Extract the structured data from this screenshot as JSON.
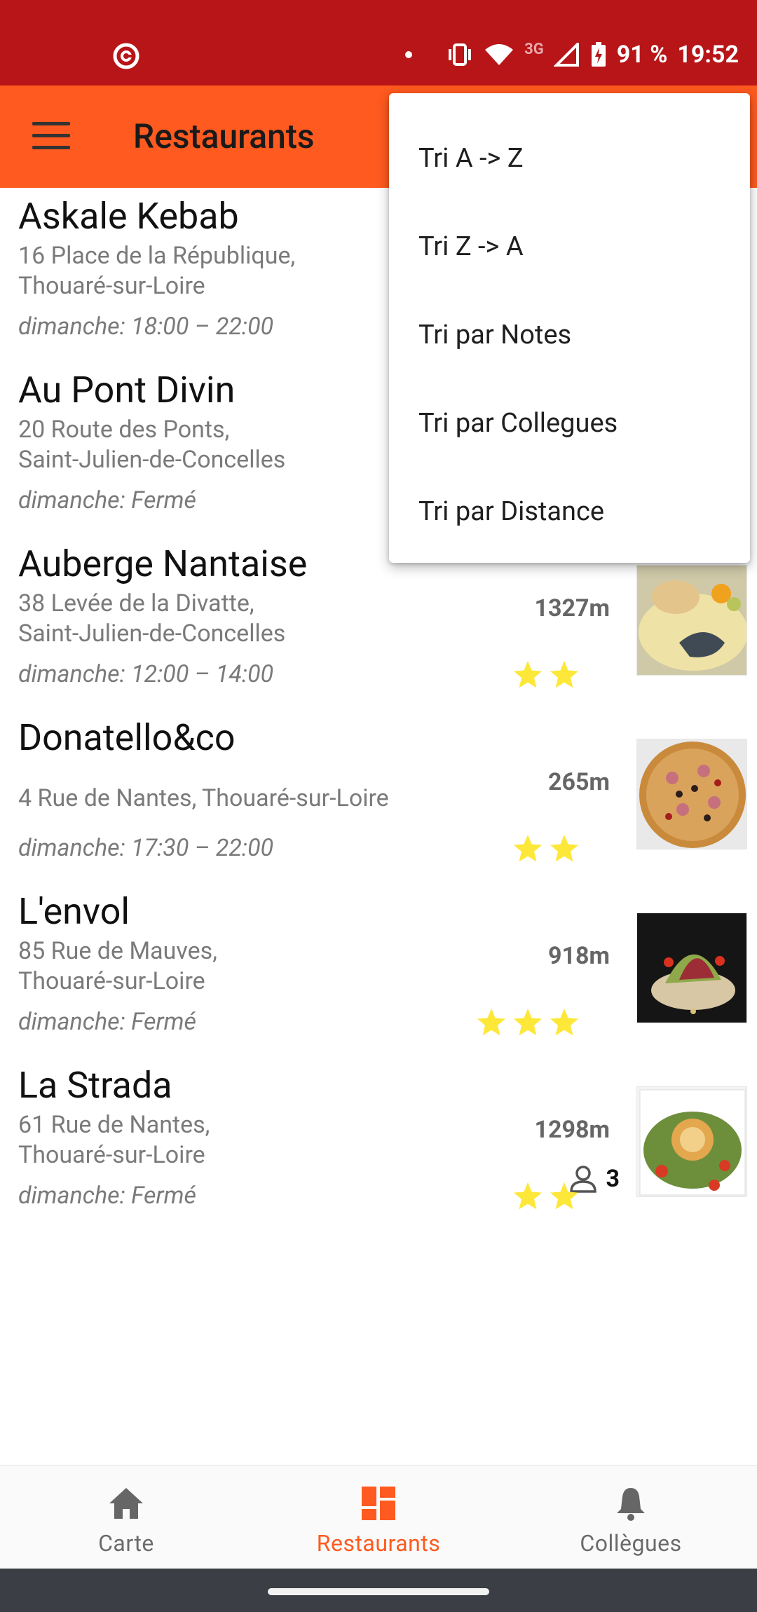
{
  "status_bar": {
    "network": "3G",
    "battery_percent": "91 %",
    "time": "19:52"
  },
  "app_bar": {
    "title": "Restaurants"
  },
  "sort_menu": {
    "options": [
      {
        "label": "Tri A -> Z"
      },
      {
        "label": "Tri Z -> A"
      },
      {
        "label": "Tri par Notes"
      },
      {
        "label": "Tri par Collegues"
      },
      {
        "label": "Tri par Distance"
      }
    ]
  },
  "restaurants": [
    {
      "name": "Askale Kebab",
      "address_line1": "16 Place de la République,",
      "address_line2": "Thouaré-sur-Loire",
      "hours": "dimanche: 18:00 – 22:00"
    },
    {
      "name": "Au Pont Divin",
      "address_line1": "20 Route des Ponts,",
      "address_line2": "Saint-Julien-de-Concelles",
      "hours": "dimanche: Fermé"
    },
    {
      "name": "Auberge Nantaise",
      "address_line1": "38 Levée de la Divatte,",
      "address_line2": "Saint-Julien-de-Concelles",
      "hours": "dimanche: 12:00 – 14:00",
      "distance": "1327m",
      "rating": 2
    },
    {
      "name": "Donatello&co",
      "address_line1": "4 Rue de Nantes, Thouaré-sur-Loire",
      "hours": "dimanche: 17:30 – 22:00",
      "distance": "265m",
      "rating": 2
    },
    {
      "name": "L'envol",
      "address_line1": "85 Rue de Mauves,",
      "address_line2": "Thouaré-sur-Loire",
      "hours": "dimanche: Fermé",
      "distance": "918m",
      "rating": 3
    },
    {
      "name": "La Strada",
      "address_line1": "61 Rue de Nantes,",
      "address_line2": "Thouaré-sur-Loire",
      "hours": "dimanche: Fermé",
      "distance": "1298m",
      "rating": 2,
      "colleagues": "3"
    }
  ],
  "bottom_nav": {
    "items": [
      {
        "label": "Carte",
        "icon": "home-icon"
      },
      {
        "label": "Restaurants",
        "icon": "dashboard-icon",
        "active": true
      },
      {
        "label": "Collègues",
        "icon": "bell-icon"
      }
    ]
  },
  "colors": {
    "status_bar": "#b71518",
    "app_bar": "#ff5a1f",
    "accent": "#ff5a1f",
    "star": "#fde83a"
  }
}
